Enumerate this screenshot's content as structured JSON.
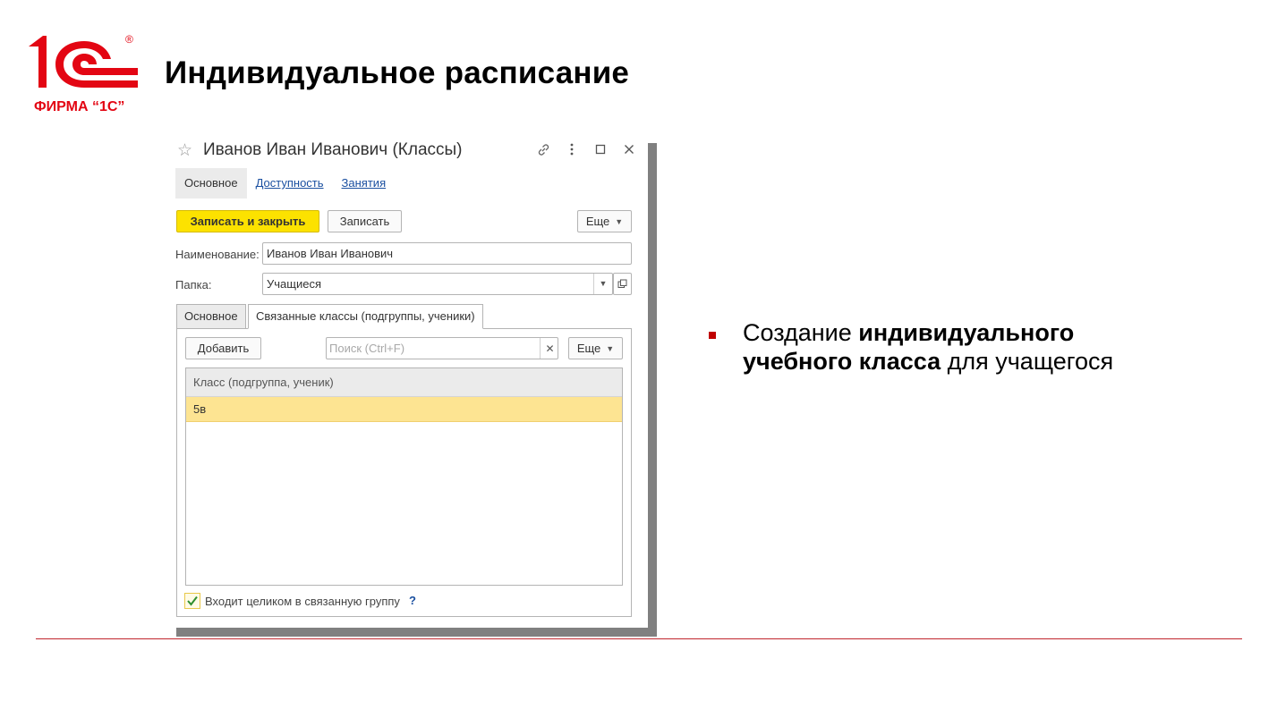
{
  "slide": {
    "title": "Индивидуальное расписание",
    "logo": {
      "registered": "®",
      "company_text": "ФИРМА “1С”",
      "brand_color": "#e30613"
    },
    "accent_color": "#c00000",
    "bullet": {
      "part1": "Создание ",
      "bold": "индивидуального учебного класса",
      "part2": " для учащегося"
    }
  },
  "window": {
    "title": "Иванов Иван Иванович (Классы)",
    "icons": [
      "star-icon",
      "link-icon",
      "more-vertical-icon",
      "maximize-icon",
      "close-icon"
    ],
    "nav_tabs": [
      {
        "label": "Основное",
        "active": true
      },
      {
        "label": "Доступность",
        "active": false
      },
      {
        "label": "Занятия",
        "active": false
      }
    ],
    "toolbar": {
      "save_close_label": "Записать и закрыть",
      "save_label": "Записать",
      "more_label": "Еще"
    },
    "fields": {
      "name_label": "Наименование:",
      "name_value": "Иванов Иван Иванович",
      "folder_label": "Папка:",
      "folder_value": "Учащиеся"
    },
    "page_tabs": [
      {
        "label": "Основное",
        "active": false
      },
      {
        "label": "Связанные классы (подгруппы, ученики)",
        "active": true
      }
    ],
    "panel": {
      "add_label": "Добавить",
      "search_placeholder": "Поиск (Ctrl+F)",
      "more_label": "Еще",
      "table": {
        "columns": [
          "Класс (подгруппа, ученик)"
        ],
        "rows": [
          {
            "cells": [
              "5в"
            ],
            "selected": true
          }
        ]
      },
      "checkbox": {
        "label": "Входит целиком в связанную группу",
        "checked": true,
        "help": "?"
      }
    }
  }
}
